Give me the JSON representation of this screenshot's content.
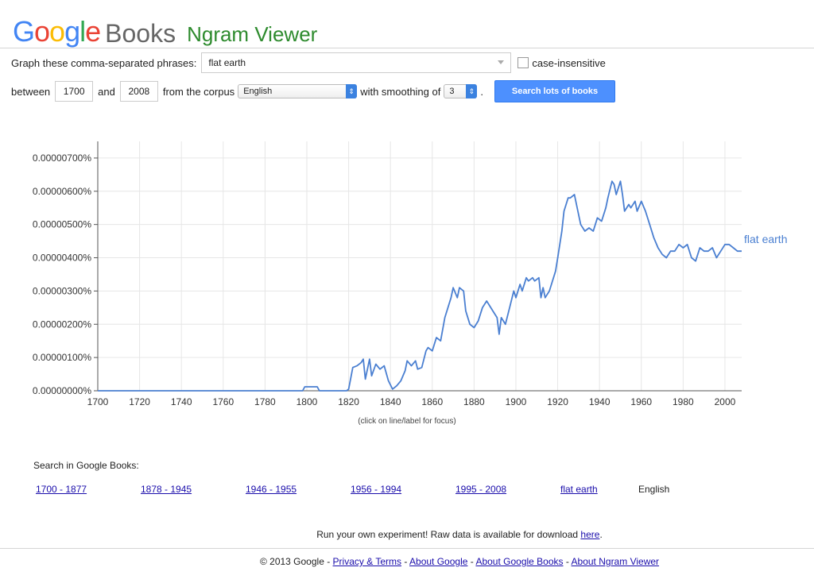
{
  "header": {
    "logo_letters": [
      "G",
      "o",
      "o",
      "g",
      "l",
      "e"
    ],
    "books": "Books",
    "title": "Ngram Viewer"
  },
  "form": {
    "phrases_label": "Graph these comma-separated phrases:",
    "phrases_value": "flat earth",
    "case_insensitive_label": "case-insensitive",
    "between_label": "between",
    "start_year": "1700",
    "and_label": "and",
    "end_year": "2008",
    "corpus_label": "from the corpus",
    "corpus_value": "English",
    "smoothing_label": "with smoothing of",
    "smoothing_value": "3",
    "period": ".",
    "search_button": "Search lots of books"
  },
  "chart_data": {
    "type": "line",
    "xlim": [
      1700,
      2008
    ],
    "ylim": [
      0,
      7.5e-08
    ],
    "x_ticks": [
      "1700",
      "1720",
      "1740",
      "1760",
      "1780",
      "1800",
      "1820",
      "1840",
      "1860",
      "1880",
      "1900",
      "1920",
      "1940",
      "1960",
      "1980",
      "2000"
    ],
    "y_ticks": [
      "0.00000000%",
      "0.00000100%",
      "0.00000200%",
      "0.00000300%",
      "0.00000400%",
      "0.00000500%",
      "0.00000600%",
      "0.00000700%"
    ],
    "series": [
      {
        "name": "flat earth",
        "color": "#4a7fd1",
        "points": [
          [
            1700,
            0
          ],
          [
            1798,
            0
          ],
          [
            1799,
            1.2e-09
          ],
          [
            1805,
            1.2e-09
          ],
          [
            1806,
            0
          ],
          [
            1819,
            0
          ],
          [
            1820,
            5e-10
          ],
          [
            1822,
            7e-09
          ],
          [
            1824,
            7.5e-09
          ],
          [
            1826,
            8.5e-09
          ],
          [
            1827,
            9.5e-09
          ],
          [
            1828,
            3.5e-09
          ],
          [
            1830,
            9.5e-09
          ],
          [
            1831,
            4.5e-09
          ],
          [
            1833,
            8e-09
          ],
          [
            1835,
            6.5e-09
          ],
          [
            1837,
            7.5e-09
          ],
          [
            1839,
            3e-09
          ],
          [
            1841,
            5e-10
          ],
          [
            1843,
            1.5e-09
          ],
          [
            1845,
            3e-09
          ],
          [
            1847,
            6e-09
          ],
          [
            1848,
            9e-09
          ],
          [
            1850,
            7.5e-09
          ],
          [
            1852,
            9e-09
          ],
          [
            1853,
            6.5e-09
          ],
          [
            1855,
            7e-09
          ],
          [
            1857,
            1.2e-08
          ],
          [
            1858,
            1.3e-08
          ],
          [
            1860,
            1.2e-08
          ],
          [
            1862,
            1.6e-08
          ],
          [
            1864,
            1.5e-08
          ],
          [
            1866,
            2.2e-08
          ],
          [
            1867,
            2.4e-08
          ],
          [
            1869,
            2.8e-08
          ],
          [
            1870,
            3.1e-08
          ],
          [
            1872,
            2.8e-08
          ],
          [
            1873,
            3.1e-08
          ],
          [
            1875,
            3e-08
          ],
          [
            1876,
            2.4e-08
          ],
          [
            1878,
            2e-08
          ],
          [
            1880,
            1.9e-08
          ],
          [
            1882,
            2.1e-08
          ],
          [
            1884,
            2.5e-08
          ],
          [
            1886,
            2.7e-08
          ],
          [
            1887,
            2.6e-08
          ],
          [
            1889,
            2.4e-08
          ],
          [
            1891,
            2.2e-08
          ],
          [
            1892,
            1.7e-08
          ],
          [
            1893,
            2.2e-08
          ],
          [
            1895,
            2e-08
          ],
          [
            1897,
            2.5e-08
          ],
          [
            1899,
            3e-08
          ],
          [
            1900,
            2.8e-08
          ],
          [
            1902,
            3.2e-08
          ],
          [
            1903,
            3e-08
          ],
          [
            1905,
            3.4e-08
          ],
          [
            1906,
            3.3e-08
          ],
          [
            1908,
            3.4e-08
          ],
          [
            1909,
            3.3e-08
          ],
          [
            1911,
            3.4e-08
          ],
          [
            1912,
            2.8e-08
          ],
          [
            1913,
            3.1e-08
          ],
          [
            1914,
            2.8e-08
          ],
          [
            1916,
            3e-08
          ],
          [
            1917,
            3.2e-08
          ],
          [
            1919,
            3.6e-08
          ],
          [
            1920,
            4e-08
          ],
          [
            1922,
            4.8e-08
          ],
          [
            1923,
            5.4e-08
          ],
          [
            1925,
            5.8e-08
          ],
          [
            1926,
            5.8e-08
          ],
          [
            1928,
            5.9e-08
          ],
          [
            1929,
            5.6e-08
          ],
          [
            1931,
            5e-08
          ],
          [
            1933,
            4.8e-08
          ],
          [
            1935,
            4.9e-08
          ],
          [
            1937,
            4.8e-08
          ],
          [
            1939,
            5.2e-08
          ],
          [
            1941,
            5.1e-08
          ],
          [
            1943,
            5.5e-08
          ],
          [
            1944,
            5.8e-08
          ],
          [
            1946,
            6.3e-08
          ],
          [
            1947,
            6.2e-08
          ],
          [
            1948,
            5.9e-08
          ],
          [
            1950,
            6.3e-08
          ],
          [
            1951,
            5.9e-08
          ],
          [
            1952,
            5.4e-08
          ],
          [
            1954,
            5.6e-08
          ],
          [
            1955,
            5.5e-08
          ],
          [
            1957,
            5.7e-08
          ],
          [
            1958,
            5.4e-08
          ],
          [
            1960,
            5.7e-08
          ],
          [
            1962,
            5.4e-08
          ],
          [
            1964,
            5e-08
          ],
          [
            1966,
            4.6e-08
          ],
          [
            1968,
            4.3e-08
          ],
          [
            1970,
            4.1e-08
          ],
          [
            1972,
            4e-08
          ],
          [
            1974,
            4.2e-08
          ],
          [
            1976,
            4.2e-08
          ],
          [
            1978,
            4.4e-08
          ],
          [
            1980,
            4.3e-08
          ],
          [
            1982,
            4.4e-08
          ],
          [
            1984,
            4e-08
          ],
          [
            1986,
            3.9e-08
          ],
          [
            1988,
            4.3e-08
          ],
          [
            1990,
            4.2e-08
          ],
          [
            1992,
            4.2e-08
          ],
          [
            1994,
            4.3e-08
          ],
          [
            1996,
            4e-08
          ],
          [
            1998,
            4.2e-08
          ],
          [
            2000,
            4.4e-08
          ],
          [
            2002,
            4.4e-08
          ],
          [
            2004,
            4.3e-08
          ],
          [
            2006,
            4.2e-08
          ],
          [
            2008,
            4.2e-08
          ]
        ]
      }
    ]
  },
  "chart_hint": "(click on line/label for focus)",
  "search_in_books": {
    "label": "Search in Google Books:",
    "links": [
      "1700 - 1877",
      "1878 - 1945",
      "1946 - 1955",
      "1956 - 1994",
      "1995 - 2008",
      "flat earth"
    ],
    "corpus": "English"
  },
  "raw": {
    "text": "Run your own experiment! Raw data is available for download",
    "link": "here",
    "end": "."
  },
  "footer": {
    "copyright": "© 2013 Google",
    "sep": " - ",
    "links": [
      "Privacy & Terms",
      "About Google",
      "About Google Books",
      "About Ngram Viewer"
    ]
  },
  "colors": {
    "accent": "#4d90fe",
    "line": "#4a7fd1",
    "title_green": "#2e8b2e"
  }
}
